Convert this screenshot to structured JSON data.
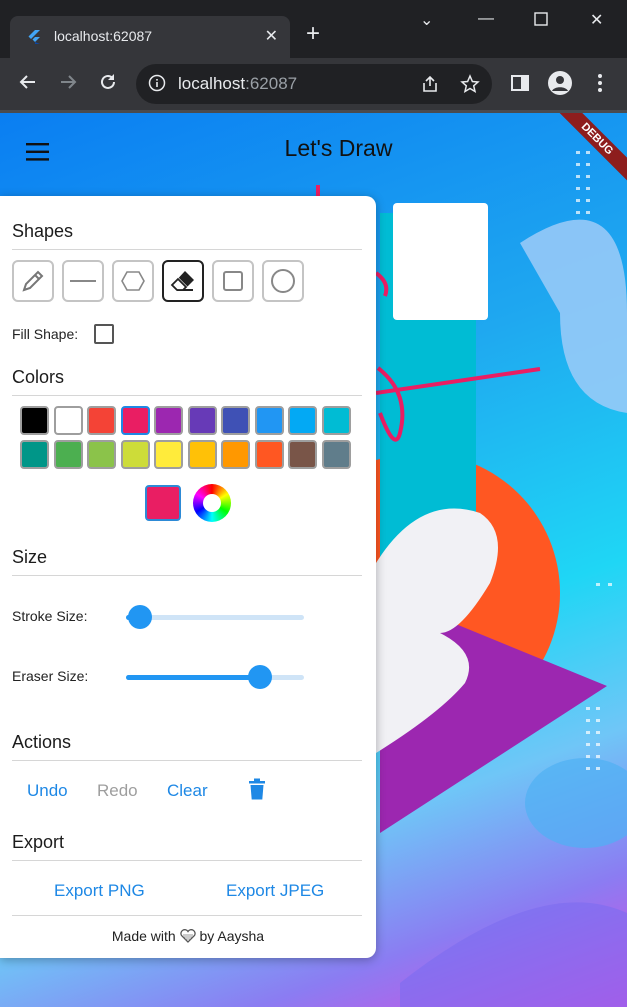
{
  "browser": {
    "tab_title": "localhost:62087",
    "url_host": "localhost",
    "url_port": ":62087"
  },
  "app": {
    "title": "Let's Draw",
    "debug_label": "DEBUG",
    "sections": {
      "shapes": "Shapes",
      "fill_label": "Fill Shape:",
      "colors": "Colors",
      "size": "Size",
      "stroke_label": "Stroke Size:",
      "eraser_label": "Eraser Size:",
      "actions": "Actions",
      "export": "Export"
    },
    "shape_tools": [
      "pencil-icon",
      "line-icon",
      "hexagon-icon",
      "eraser-icon",
      "square-icon",
      "circle-icon"
    ],
    "selected_tool": "eraser-icon",
    "fill_shape": false,
    "palette": [
      "#000000",
      "#ffffff",
      "#f44336",
      "#e91e63",
      "#9c27b0",
      "#673ab7",
      "#3f51b5",
      "#2196f3",
      "#03a9f4",
      "#00bcd4",
      "#009688",
      "#4caf50",
      "#8bc34a",
      "#cddc39",
      "#ffeb3b",
      "#ffc107",
      "#ff9800",
      "#ff5722",
      "#795548",
      "#607d8b"
    ],
    "selected_color": "#e91e63",
    "stroke_size": 0.08,
    "eraser_size": 0.75,
    "actions": {
      "undo": "Undo",
      "redo": "Redo",
      "clear": "Clear"
    },
    "export": {
      "png": "Export PNG",
      "jpeg": "Export JPEG"
    },
    "footer": {
      "prefix": "Made with",
      "suffix": "by Aaysha"
    }
  }
}
